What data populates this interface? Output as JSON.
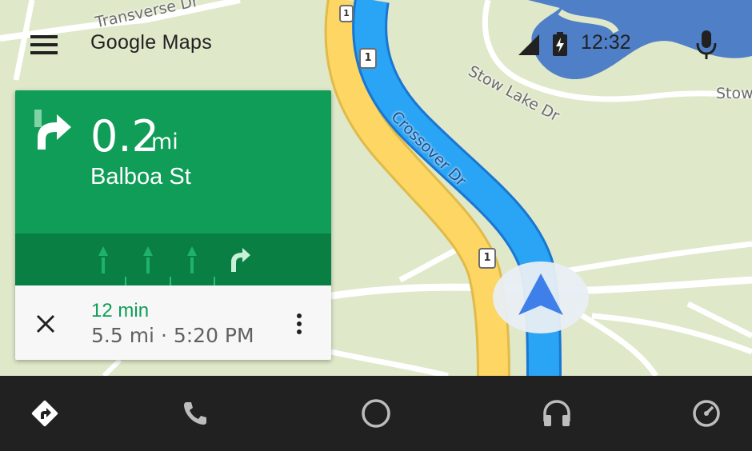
{
  "header": {
    "app_title": "Google Maps",
    "time": "12:32",
    "menu_icon": "menu-icon",
    "signal_icon": "cell-signal-icon",
    "battery_icon": "battery-charging-icon",
    "mic_icon": "microphone-icon"
  },
  "map": {
    "labels": {
      "transverse": "Transverse Dr",
      "stow_lake": "Stow Lake Dr",
      "stow_edge": "Stow",
      "crossover": "Crossover Dr"
    },
    "route_shields": [
      "1",
      "1",
      "1"
    ],
    "colors": {
      "route": "#2196f3",
      "highway": "#fdd663",
      "land": "#dfe8c9",
      "water": "#4f7fc7"
    }
  },
  "navigation": {
    "distance_value": "0.2",
    "distance_unit": "mi",
    "street": "Balboa St",
    "turn_icon": "turn-right-icon",
    "lanes": [
      "straight",
      "straight",
      "straight",
      "turn-right"
    ],
    "eta_time": "12 min",
    "eta_detail": "5.5 mi · 5:20 PM",
    "close_icon": "close-icon",
    "more_icon": "more-vert-icon"
  },
  "bottom_nav": [
    {
      "name": "navigation",
      "icon": "directions-icon"
    },
    {
      "name": "phone",
      "icon": "phone-icon"
    },
    {
      "name": "home",
      "icon": "home-circle-icon"
    },
    {
      "name": "music",
      "icon": "headphones-icon"
    },
    {
      "name": "overview",
      "icon": "dashboard-icon"
    }
  ],
  "colors": {
    "nav_green": "#0f9d58",
    "nav_green_dark": "#0a7f44",
    "bar": "#212121"
  }
}
